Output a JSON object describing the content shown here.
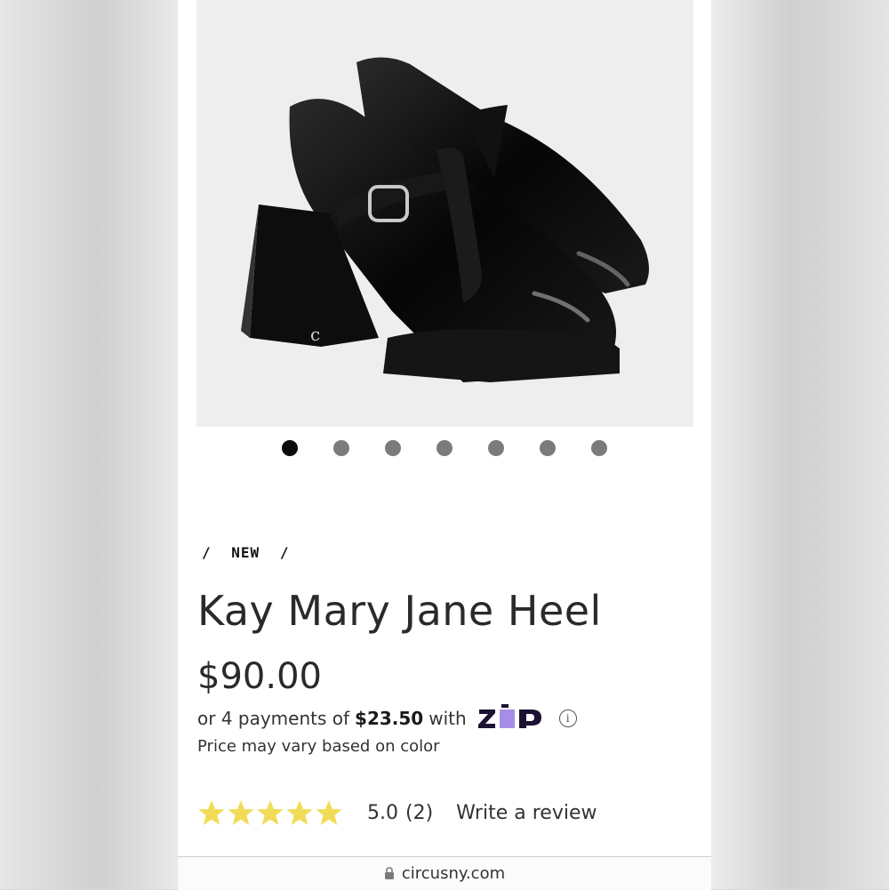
{
  "gallery": {
    "image_alt": "Black patent Mary Jane platform heels",
    "dot_count": 7,
    "active_index": 0
  },
  "breadcrumb": {
    "separator": "/",
    "current": "NEW"
  },
  "product": {
    "title": "Kay Mary Jane Heel",
    "price": "$90.00",
    "installment_prefix": "or 4 payments of",
    "installment_amount": "$23.50",
    "installment_suffix": "with",
    "price_note": "Price may vary based on color",
    "zip_logo_name": "zip-logo"
  },
  "rating": {
    "stars": 5,
    "value": "5.0",
    "count": "(2)",
    "write_review": "Write a review",
    "star_color": "#f1dc57"
  },
  "browser": {
    "url": "circusny.com"
  },
  "colors": {
    "accent_purple": "#a88de6",
    "zip_text": "#1c1130"
  }
}
